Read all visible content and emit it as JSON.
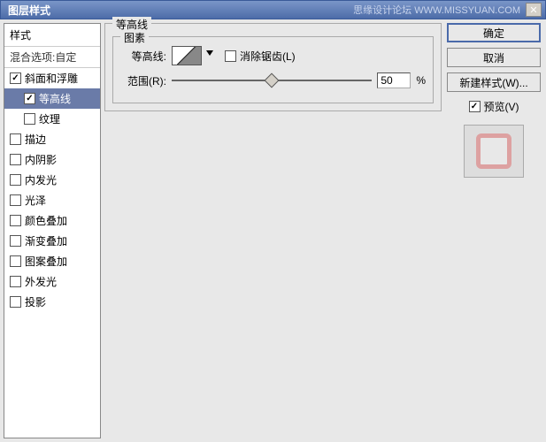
{
  "window": {
    "title": "图层样式",
    "watermark": "思缘设计论坛 WWW.MISSYUAN.COM"
  },
  "stylesPanel": {
    "header": "样式",
    "blendOptions": "混合选项:自定",
    "items": [
      {
        "label": "斜面和浮雕",
        "checked": true,
        "indent": false,
        "selected": false
      },
      {
        "label": "等高线",
        "checked": true,
        "indent": true,
        "selected": true
      },
      {
        "label": "纹理",
        "checked": false,
        "indent": true,
        "selected": false
      },
      {
        "label": "描边",
        "checked": false,
        "indent": false,
        "selected": false
      },
      {
        "label": "内阴影",
        "checked": false,
        "indent": false,
        "selected": false
      },
      {
        "label": "内发光",
        "checked": false,
        "indent": false,
        "selected": false
      },
      {
        "label": "光泽",
        "checked": false,
        "indent": false,
        "selected": false
      },
      {
        "label": "颜色叠加",
        "checked": false,
        "indent": false,
        "selected": false
      },
      {
        "label": "渐变叠加",
        "checked": false,
        "indent": false,
        "selected": false
      },
      {
        "label": "图案叠加",
        "checked": false,
        "indent": false,
        "selected": false
      },
      {
        "label": "外发光",
        "checked": false,
        "indent": false,
        "selected": false
      },
      {
        "label": "投影",
        "checked": false,
        "indent": false,
        "selected": false
      }
    ]
  },
  "settings": {
    "groupTitle": "等高线",
    "elementsTitle": "图素",
    "contourLabel": "等高线:",
    "antiAliasLabel": "消除锯齿(L)",
    "rangeLabel": "范围(R):",
    "rangeValue": "50",
    "rangeUnit": "%"
  },
  "buttons": {
    "ok": "确定",
    "cancel": "取消",
    "newStyle": "新建样式(W)...",
    "previewLabel": "预览(V)"
  }
}
